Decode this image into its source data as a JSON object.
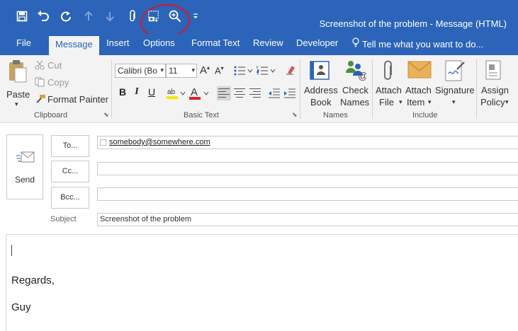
{
  "window": {
    "title": "Screenshot of the problem - Message (HTML)"
  },
  "qat": {
    "icons": [
      "save-icon",
      "undo-icon",
      "redo-icon",
      "up-arrow-icon",
      "down-arrow-icon",
      "attach-icon",
      "screenshot-icon",
      "zoom-icon",
      "customize-icon"
    ]
  },
  "tabs": [
    {
      "label": "File"
    },
    {
      "label": "Message",
      "active": true
    },
    {
      "label": "Insert"
    },
    {
      "label": "Options"
    },
    {
      "label": "Format Text"
    },
    {
      "label": "Review"
    },
    {
      "label": "Developer"
    }
  ],
  "tell_me": "Tell me what you want to do...",
  "ribbon": {
    "clipboard": {
      "label": "Clipboard",
      "paste": "Paste",
      "cut": "Cut",
      "copy": "Copy",
      "format_painter": "Format Painter"
    },
    "basic_text": {
      "label": "Basic Text",
      "font": "Calibri (Bo",
      "size": "11",
      "bold": "B",
      "italic": "I",
      "underline": "U"
    },
    "names": {
      "label": "Names",
      "address_book_1": "Address",
      "address_book_2": "Book",
      "check_names_1": "Check",
      "check_names_2": "Names"
    },
    "include": {
      "label": "Include",
      "attach_file_1": "Attach",
      "attach_file_2": "File",
      "attach_item_1": "Attach",
      "attach_item_2": "Item",
      "signature": "Signature"
    },
    "tags": {
      "assign_policy_1": "Assign",
      "assign_policy_2": "Policy"
    }
  },
  "compose": {
    "send": "Send",
    "to_button": "To...",
    "cc_button": "Cc...",
    "bcc_button": "Bcc...",
    "to_value": "somebody@somewhere.com",
    "cc_value": "",
    "bcc_value": "",
    "subject_label": "Subject",
    "subject_value": "Screenshot of the problem",
    "body_lines": [
      "Regards,",
      "Guy"
    ]
  },
  "colors": {
    "accent": "#2b64b8",
    "ribbon_bg": "#f3f3f3",
    "annotation": "#d4192a"
  }
}
